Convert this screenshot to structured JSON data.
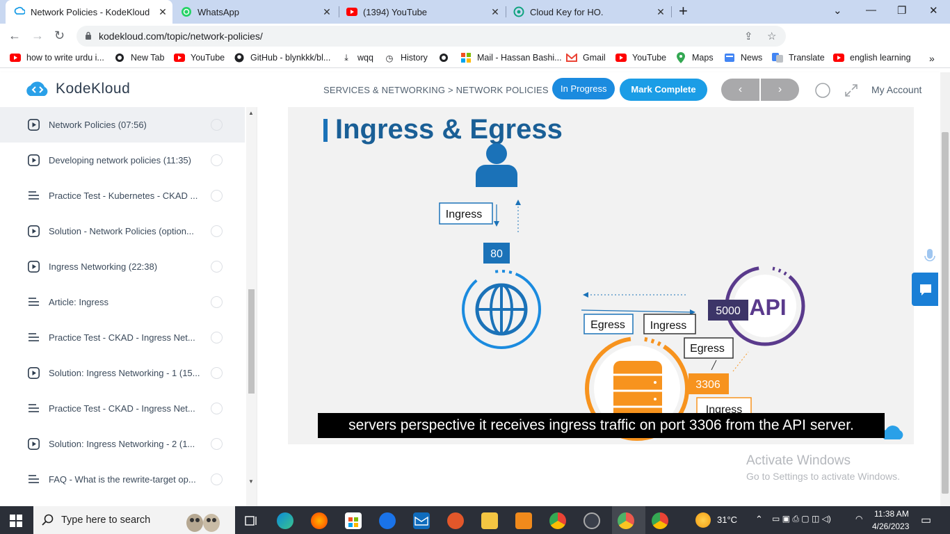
{
  "browser": {
    "tabs": [
      {
        "label": "Network Policies - KodeKloud",
        "active": true
      },
      {
        "label": "WhatsApp",
        "active": false
      },
      {
        "label": "(1394) YouTube",
        "active": false
      },
      {
        "label": "Cloud Key for HO.",
        "active": false
      }
    ],
    "url": "kodekloud.com/topic/network-policies/",
    "bookmarks": [
      {
        "label": "how to write urdu i...",
        "icon": "youtube-icon"
      },
      {
        "label": "New Tab",
        "icon": "globe-icon"
      },
      {
        "label": "YouTube",
        "icon": "youtube-icon"
      },
      {
        "label": "GitHub - blynkkk/bl...",
        "icon": "github-icon"
      },
      {
        "label": "wqq",
        "icon": "download-icon"
      },
      {
        "label": "History",
        "icon": "history-icon"
      },
      {
        "label": "",
        "icon": "globe-icon"
      },
      {
        "label": "Mail - Hassan Bashi...",
        "icon": "microsoft-icon"
      },
      {
        "label": "Gmail",
        "icon": "gmail-icon"
      },
      {
        "label": "YouTube",
        "icon": "youtube-icon"
      },
      {
        "label": "Maps",
        "icon": "maps-icon"
      },
      {
        "label": "News",
        "icon": "news-icon"
      },
      {
        "label": "Translate",
        "icon": "translate-icon"
      },
      {
        "label": "english learning",
        "icon": "youtube-icon"
      }
    ]
  },
  "site": {
    "logo_text": "KodeKloud",
    "breadcrumb": "SERVICES & NETWORKING > NETWORK POLICIES",
    "in_progress_label": "In Progress",
    "mark_complete_label": "Mark Complete",
    "prev_label": "‹",
    "next_label": "›",
    "my_account_label": "My Account",
    "accent_color": "#1b9de6"
  },
  "sidebar": {
    "lessons": [
      {
        "title": "Network Policies (07:56)",
        "kind": "video",
        "current": true
      },
      {
        "title": "Developing network policies (11:35)",
        "kind": "video",
        "current": false
      },
      {
        "title": "Practice Test - Kubernetes - CKAD ...",
        "kind": "lab",
        "current": false
      },
      {
        "title": "Solution - Network Policies (option...",
        "kind": "video",
        "current": false
      },
      {
        "title": "Ingress Networking (22:38)",
        "kind": "video",
        "current": false
      },
      {
        "title": "Article: Ingress",
        "kind": "lab",
        "current": false
      },
      {
        "title": "Practice Test - CKAD - Ingress Net...",
        "kind": "lab",
        "current": false
      },
      {
        "title": "Solution: Ingress Networking - 1 (15...",
        "kind": "video",
        "current": false
      },
      {
        "title": "Practice Test - CKAD - Ingress Net...",
        "kind": "lab",
        "current": false
      },
      {
        "title": "Solution: Ingress Networking - 2 (1...",
        "kind": "video",
        "current": false
      },
      {
        "title": "FAQ - What is the rewrite-target op...",
        "kind": "lab",
        "current": false
      }
    ]
  },
  "video": {
    "slide_title": "Ingress & Egress",
    "labels": {
      "ingress_top": "Ingress",
      "port_80": "80",
      "port_5000": "5000",
      "api": "API",
      "egress_left": "Egress",
      "ingress_mid": "Ingress",
      "egress_right": "Egress",
      "port_3306": "3306",
      "ingress_bottom": "Ingress"
    },
    "caption": "servers perspective it receives ingress traffic on port 3306 from the API server."
  },
  "watermark": {
    "line1": "Activate Windows",
    "line2": "Go to Settings to activate Windows."
  },
  "taskbar": {
    "search_placeholder": "Type here to search",
    "temperature": "31°C",
    "time": "11:38 AM",
    "date": "4/26/2023"
  }
}
